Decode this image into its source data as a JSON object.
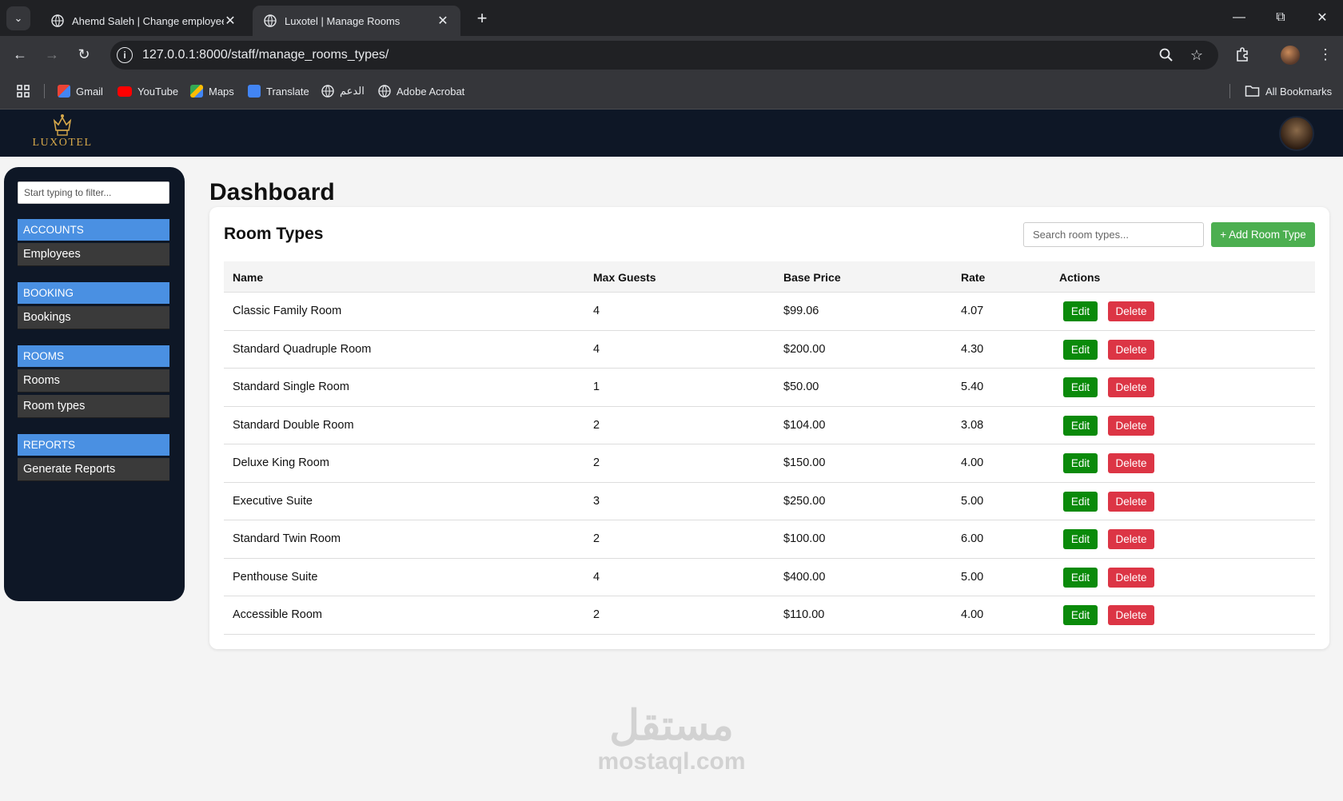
{
  "browser": {
    "tabs": [
      {
        "title": "Ahemd Saleh | Change employee |",
        "active": false
      },
      {
        "title": "Luxotel | Manage Rooms",
        "active": true
      }
    ],
    "url": "127.0.0.1:8000/staff/manage_rooms_types/",
    "bookmarks": [
      "Gmail",
      "YouTube",
      "Maps",
      "Translate",
      "الدعم",
      "Adobe Acrobat"
    ],
    "all_bookmarks_label": "All Bookmarks"
  },
  "header": {
    "logo_text": "LUXOTEL",
    "brand_color": "#d6a84a",
    "bg_color": "#0e1726"
  },
  "sidebar": {
    "filter_placeholder": "Start typing to filter...",
    "sections": [
      {
        "title": "ACCOUNTS",
        "items": [
          "Employees"
        ]
      },
      {
        "title": "BOOKING",
        "items": [
          "Bookings"
        ]
      },
      {
        "title": "ROOMS",
        "items": [
          "Rooms",
          "Room types"
        ]
      },
      {
        "title": "REPORTS",
        "items": [
          "Generate Reports"
        ]
      }
    ],
    "section_color": "#4a90e2"
  },
  "main": {
    "page_title": "Dashboard",
    "card_title": "Room Types",
    "search_placeholder": "Search room types...",
    "add_button_label": "+ Add Room Type",
    "columns": [
      "Name",
      "Max Guests",
      "Base Price",
      "Rate",
      "Actions"
    ],
    "edit_label": "Edit",
    "delete_label": "Delete",
    "rows": [
      {
        "name": "Classic Family Room",
        "max_guests": "4",
        "base_price": "$99.06",
        "rate": "4.07"
      },
      {
        "name": "Standard Quadruple Room",
        "max_guests": "4",
        "base_price": "$200.00",
        "rate": "4.30"
      },
      {
        "name": "Standard Single Room",
        "max_guests": "1",
        "base_price": "$50.00",
        "rate": "5.40"
      },
      {
        "name": "Standard Double Room",
        "max_guests": "2",
        "base_price": "$104.00",
        "rate": "3.08"
      },
      {
        "name": "Deluxe King Room",
        "max_guests": "2",
        "base_price": "$150.00",
        "rate": "4.00"
      },
      {
        "name": "Executive Suite",
        "max_guests": "3",
        "base_price": "$250.00",
        "rate": "5.00"
      },
      {
        "name": "Standard Twin Room",
        "max_guests": "2",
        "base_price": "$100.00",
        "rate": "6.00"
      },
      {
        "name": "Penthouse Suite",
        "max_guests": "4",
        "base_price": "$400.00",
        "rate": "5.00"
      },
      {
        "name": "Accessible Room",
        "max_guests": "2",
        "base_price": "$110.00",
        "rate": "4.00"
      }
    ],
    "colors": {
      "add": "#4caf50",
      "edit": "#0a8a0a",
      "delete": "#dc3545"
    }
  },
  "watermark": {
    "arabic": "مستقل",
    "latin": "mostaql.com"
  }
}
